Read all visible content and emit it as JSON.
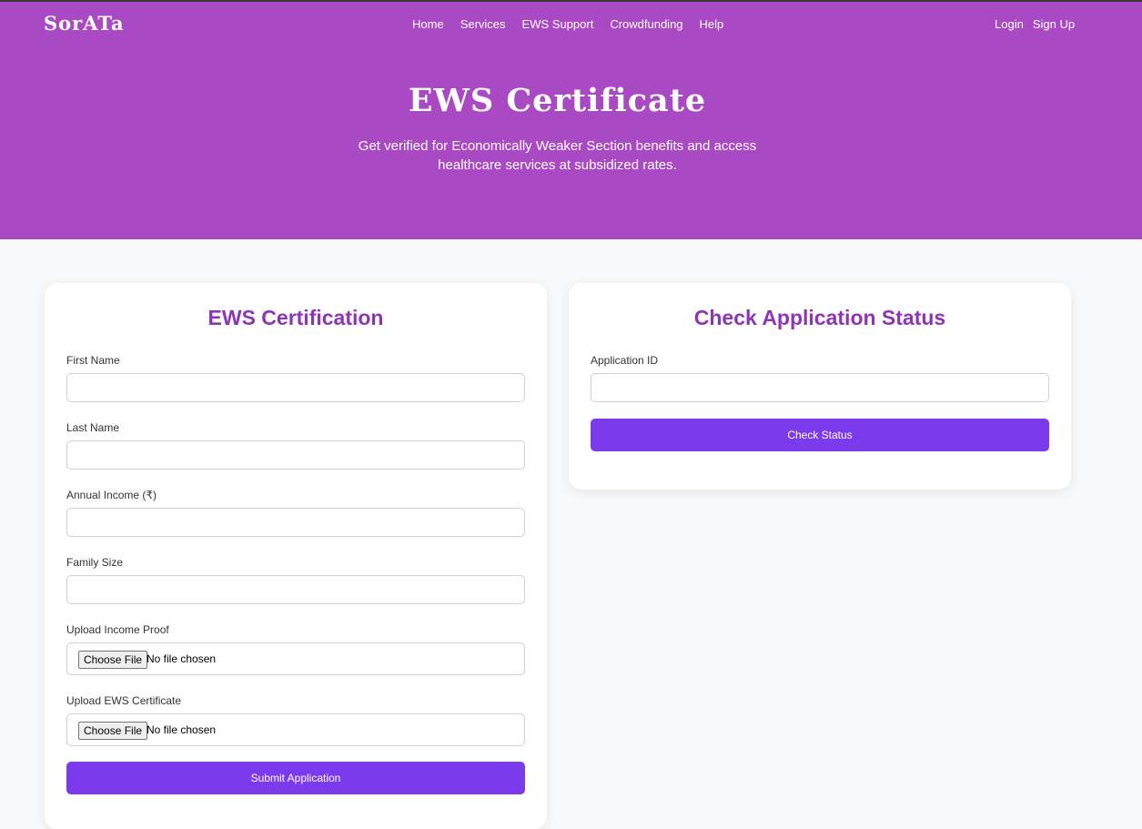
{
  "brand": "SorATa",
  "nav": {
    "home": "Home",
    "services": "Services",
    "ews_support": "EWS Support",
    "crowdfunding": "Crowdfunding",
    "help": "Help"
  },
  "auth": {
    "login": "Login",
    "signup": "Sign Up"
  },
  "hero": {
    "title": "EWS Certificate",
    "subtitle": "Get verified for Economically Weaker Section benefits and access healthcare services at subsidized rates."
  },
  "certification_form": {
    "title": "EWS Certification",
    "first_name_label": "First Name",
    "first_name_value": "",
    "last_name_label": "Last Name",
    "last_name_value": "",
    "income_label": "Annual Income (₹)",
    "income_value": "",
    "family_size_label": "Family Size",
    "family_size_value": "",
    "income_proof_label": "Upload Income Proof",
    "ews_cert_label": "Upload EWS Certificate",
    "choose_file": "Choose File",
    "no_file": "No file chosen",
    "submit": "Submit Application"
  },
  "status_form": {
    "title": "Check Application Status",
    "app_id_label": "Application ID",
    "app_id_value": "",
    "check": "Check Status"
  },
  "colors": {
    "hero_bg": "#aa49c4",
    "accent_title": "#8e35b5",
    "button": "#7c3aed",
    "page_bg": "#f8f9fb"
  }
}
